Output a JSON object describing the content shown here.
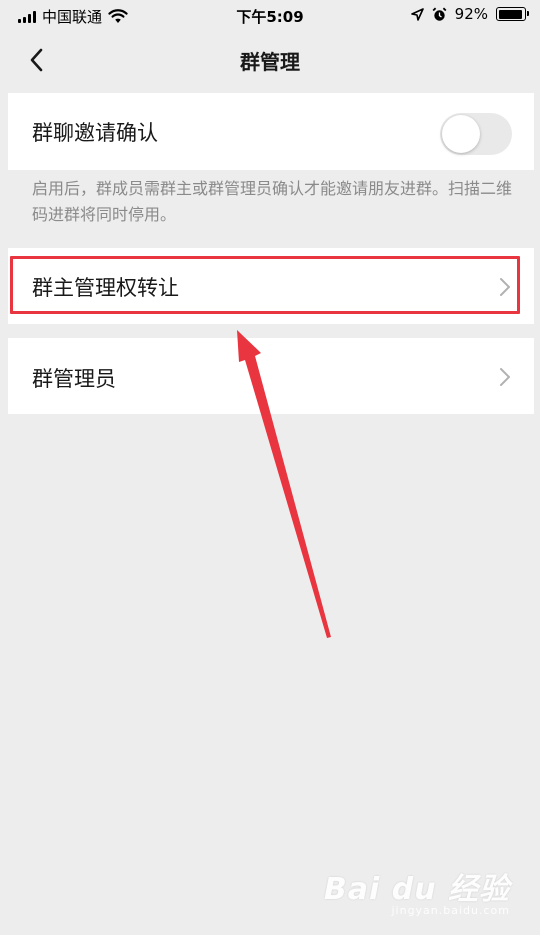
{
  "status_bar": {
    "carrier": "中国联通",
    "time": "下午5:09",
    "battery_percent": "92%",
    "battery_level": 0.92,
    "icons": [
      "signal-icon",
      "wifi-icon",
      "location-icon",
      "alarm-icon",
      "battery-icon"
    ]
  },
  "nav": {
    "title": "群管理",
    "back_icon": "chevron-left-icon"
  },
  "settings": {
    "invite_confirm": {
      "label": "群聊邀请确认",
      "enabled": false
    },
    "invite_description": "启用后，群成员需群主或群管理员确认才能邀请朋友进群。扫描二维码进群将同时停用。",
    "transfer_owner": {
      "label": "群主管理权转让"
    },
    "admins": {
      "label": "群管理员"
    }
  },
  "annotation": {
    "highlight_color": "#e8353f",
    "arrow_color": "#e8353f"
  },
  "watermark": {
    "logo": "Bai du 经验",
    "url": "jingyan.baidu.com"
  },
  "colors": {
    "background": "#ededed",
    "row_background": "#ffffff",
    "description_text": "#8a8a8a",
    "toggle_off": "#e9e9ea"
  }
}
